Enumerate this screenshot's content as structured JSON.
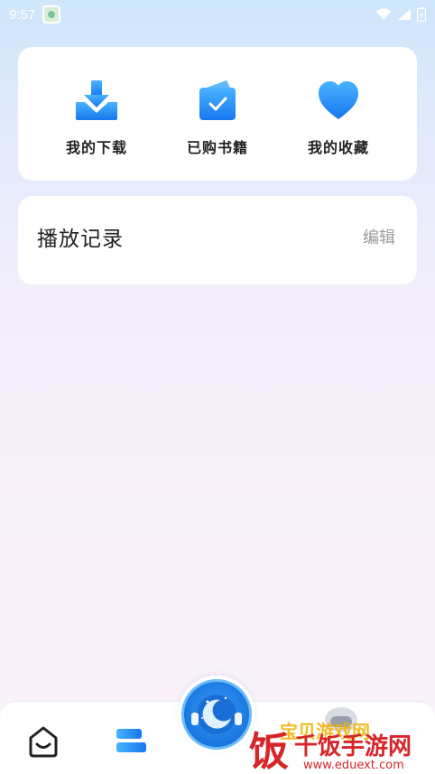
{
  "status_bar": {
    "time": "9:57"
  },
  "quick_actions": [
    {
      "label": "我的下载",
      "icon": "download-icon"
    },
    {
      "label": "已购书籍",
      "icon": "purchased-books-icon"
    },
    {
      "label": "我的收藏",
      "icon": "heart-icon"
    }
  ],
  "history": {
    "title": "播放记录",
    "edit_label": "编辑"
  },
  "bottom_nav": {
    "items": [
      {
        "icon": "home-icon"
      },
      {
        "icon": "library-icon"
      },
      {
        "icon": "player-icon"
      }
    ]
  },
  "watermark": {
    "site": "www.eduext.com",
    "name": "饭千饭手游网"
  },
  "colors": {
    "accent": "#1b8cf2",
    "text": "#222222",
    "muted": "#9a9a9a"
  }
}
